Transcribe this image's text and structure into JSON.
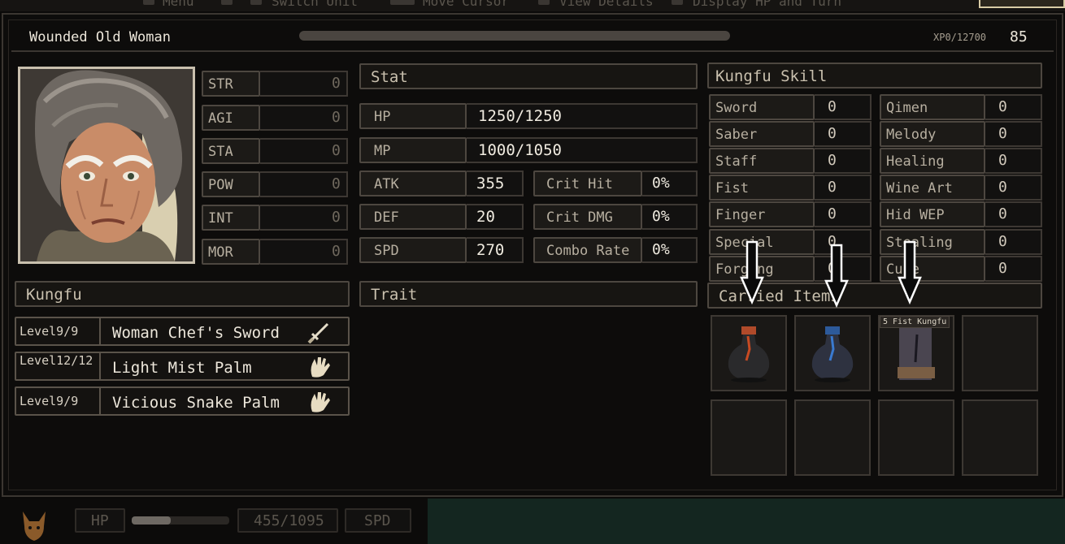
{
  "top_hints": [
    "Menu",
    "Switch Unit",
    "Move Cursor",
    "View Details",
    "Display HP and Turn"
  ],
  "header": {
    "name": "Wounded Old Woman",
    "xp": "XP0/12700",
    "level": "85"
  },
  "attributes": [
    {
      "label": "STR",
      "value": "0"
    },
    {
      "label": "AGI",
      "value": "0"
    },
    {
      "label": "STA",
      "value": "0"
    },
    {
      "label": "POW",
      "value": "0"
    },
    {
      "label": "INT",
      "value": "0"
    },
    {
      "label": "MOR",
      "value": "0"
    }
  ],
  "stat": {
    "title": "Stat",
    "hp_label": "HP",
    "hp_value": "1250/1250",
    "mp_label": "MP",
    "mp_value": "1000/1050",
    "atk_label": "ATK",
    "atk_value": "355",
    "def_label": "DEF",
    "def_value": "20",
    "spd_label": "SPD",
    "spd_value": "270",
    "crit_hit_label": "Crit Hit",
    "crit_hit_value": "0%",
    "crit_dmg_label": "Crit DMG",
    "crit_dmg_value": "0%",
    "combo_label": "Combo Rate",
    "combo_value": "0%"
  },
  "kungfu_skill": {
    "title": "Kungfu Skill",
    "skills": [
      {
        "label": "Sword",
        "value": "0"
      },
      {
        "label": "Qimen",
        "value": "0"
      },
      {
        "label": "Saber",
        "value": "0"
      },
      {
        "label": "Melody",
        "value": "0"
      },
      {
        "label": "Staff",
        "value": "0"
      },
      {
        "label": "Healing",
        "value": "0"
      },
      {
        "label": "Fist",
        "value": "0"
      },
      {
        "label": "Wine Art",
        "value": "0"
      },
      {
        "label": "Finger",
        "value": "0"
      },
      {
        "label": "Hid WEP",
        "value": "0"
      },
      {
        "label": "Special",
        "value": "0"
      },
      {
        "label": "Stealing",
        "value": "0"
      },
      {
        "label": "Forging",
        "value": "0"
      },
      {
        "label": "Cure",
        "value": "0"
      }
    ]
  },
  "kungfu": {
    "title": "Kungfu",
    "entries": [
      {
        "level": "Level9/9",
        "name": "Woman Chef's Sword",
        "icon": "sword-icon"
      },
      {
        "level": "Level12/12",
        "name": "Light Mist Palm",
        "icon": "palm-icon"
      },
      {
        "level": "Level9/9",
        "name": "Vicious Snake Palm",
        "icon": "palm-icon"
      }
    ]
  },
  "trait": {
    "title": "Trait"
  },
  "carried_items": {
    "title": "Carried Items",
    "tooltip": "5 Fist Kungfu",
    "items": [
      "red-potion-icon",
      "blue-potion-icon",
      "scroll-icon"
    ]
  },
  "bottom_hud": {
    "hp_label": "HP",
    "hp_value": "455/1095",
    "spd_label": "SPD"
  },
  "colors": {
    "accent": "#c9c0ae",
    "border": "#524b43",
    "background": "#0d0c0b"
  }
}
